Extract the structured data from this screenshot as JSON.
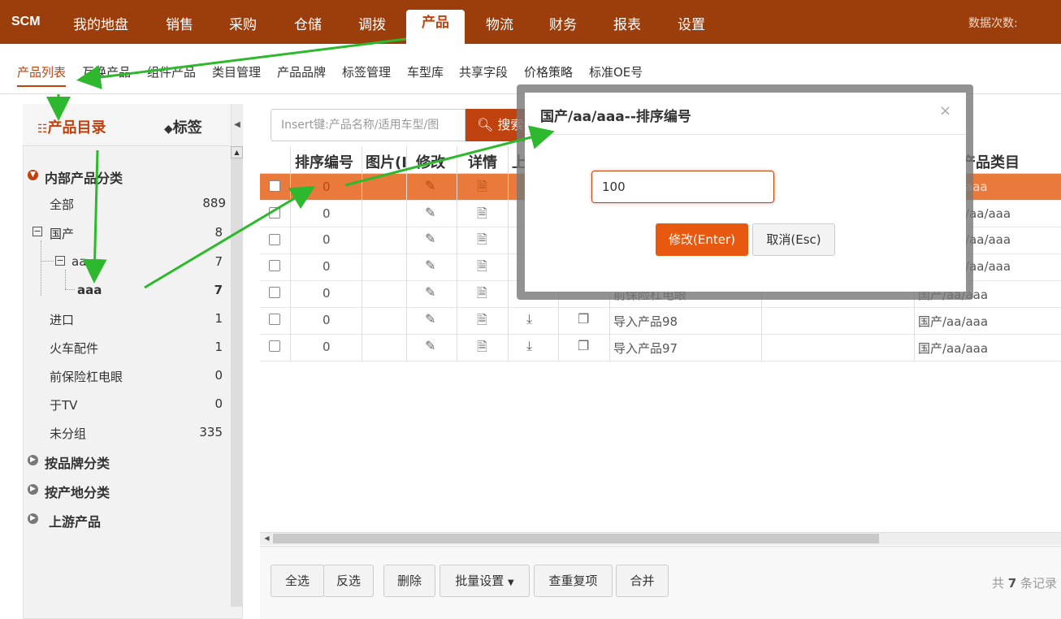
{
  "topnav": {
    "logo": "SCM",
    "items": [
      "我的地盘",
      "销售",
      "采购",
      "仓储",
      "调拨",
      "产品",
      "物流",
      "财务",
      "报表",
      "设置"
    ],
    "active": "产品",
    "right_text": "数据次数:"
  },
  "subnav": {
    "items": [
      "产品列表",
      "互换产品",
      "组件产品",
      "类目管理",
      "产品品牌",
      "标签管理",
      "车型库",
      "共享字段",
      "价格策略",
      "标准OE号"
    ],
    "active": "产品列表"
  },
  "left": {
    "tab_catalog": "产品目录",
    "tab_tags": "标签",
    "group_internal": "内部产品分类",
    "tree": [
      {
        "label": "全部",
        "count": "889"
      },
      {
        "label": "国产",
        "count": "8"
      },
      {
        "label": "aa",
        "count": "7"
      },
      {
        "label": "aaa",
        "count": "7"
      },
      {
        "label": "进口",
        "count": "1"
      },
      {
        "label": "火车配件",
        "count": "1"
      },
      {
        "label": "前保险杠电眼",
        "count": "0"
      },
      {
        "label": "于TV",
        "count": "0"
      },
      {
        "label": "未分组",
        "count": "335"
      }
    ],
    "groups": [
      "按品牌分类",
      "按产地分类",
      "上游产品"
    ]
  },
  "search": {
    "placeholder": "Insert键:产品名称/适用车型/图",
    "button": "搜索"
  },
  "table": {
    "headers": [
      "排序编号",
      "图片(I",
      "修改",
      "详情",
      "上",
      "产品类目"
    ],
    "rows": [
      {
        "sort": "0",
        "name": "",
        "category": "aaa",
        "selected": true
      },
      {
        "sort": "0",
        "name": "",
        "category": "/aa/aaa"
      },
      {
        "sort": "0",
        "name": "",
        "category": "/aa/aaa"
      },
      {
        "sort": "0",
        "name": "",
        "category": "/aa/aaa"
      },
      {
        "sort": "0",
        "name": "前保险杠电眼",
        "category": "国产/aa/aaa"
      },
      {
        "sort": "0",
        "name": "导入产品98",
        "category": "国产/aa/aaa"
      },
      {
        "sort": "0",
        "name": "导入产品97",
        "category": "国产/aa/aaa"
      }
    ]
  },
  "footer": {
    "buttons": [
      "全选",
      "反选",
      "删除",
      "批量设置",
      "查重复项",
      "合并"
    ],
    "total_prefix": "共",
    "total": "7",
    "total_suffix": "条记录"
  },
  "modal": {
    "title": "国产/aa/aaa--排序编号",
    "close": "×",
    "input_value": "100",
    "ok": "修改(Enter)",
    "cancel": "取消(Esc)"
  },
  "colors": {
    "brand": "#9c3e0c",
    "accent": "#c0420f",
    "selected_row": "#e97a3c",
    "arrow": "#2db82d"
  }
}
